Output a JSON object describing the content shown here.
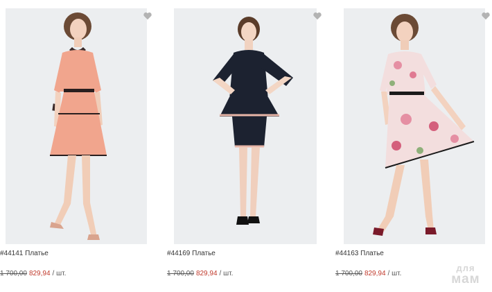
{
  "products": [
    {
      "name": "#44141 Платье",
      "old_price": "1 700,00",
      "new_price": "829,94",
      "unit": "/ шт.",
      "dress_color": "#f1a58d",
      "trim_color": "#2a1f1f",
      "favorite_icon": "heart-icon"
    },
    {
      "name": "#44169 Платье",
      "old_price": "1 700,00",
      "new_price": "829,94",
      "unit": "/ шт.",
      "dress_color": "#1c2230",
      "trim_color": "#e8b6a8",
      "favorite_icon": "heart-icon"
    },
    {
      "name": "#44163 Платье",
      "old_price": "1 700,00",
      "new_price": "829,94",
      "unit": "/ шт.",
      "dress_color": "#f3dede",
      "trim_color": "#1a1a1a",
      "favorite_icon": "heart-icon"
    }
  ],
  "watermark": {
    "line1": "для",
    "line2": "мам"
  },
  "colors": {
    "sale_price": "#c0392b",
    "photo_bg": "#eceef0",
    "heart": "#b3b3b3"
  }
}
